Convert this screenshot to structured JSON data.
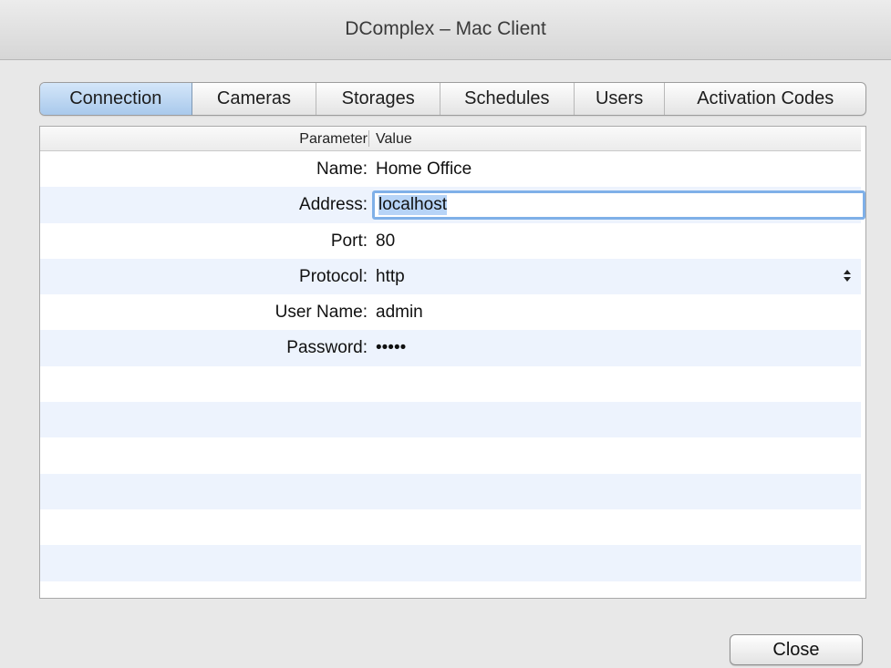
{
  "window": {
    "title": "DComplex – Mac Client"
  },
  "tabs": [
    {
      "label": "Connection",
      "active": true
    },
    {
      "label": "Cameras",
      "active": false
    },
    {
      "label": "Storages",
      "active": false
    },
    {
      "label": "Schedules",
      "active": false
    },
    {
      "label": "Users",
      "active": false
    },
    {
      "label": "Activation Codes",
      "active": false
    }
  ],
  "table": {
    "columns": [
      "Parameter",
      "Value"
    ],
    "rows": [
      {
        "label": "Name:",
        "value": "Home Office"
      },
      {
        "label": "Address:",
        "value": "localhost",
        "editing": true
      },
      {
        "label": "Port:",
        "value": "80"
      },
      {
        "label": "Protocol:",
        "value": "http",
        "control": "up-down-stepper"
      },
      {
        "label": "User Name:",
        "value": "admin"
      },
      {
        "label": "Password:",
        "value": "•••••"
      }
    ]
  },
  "buttons": {
    "close_label": "Close"
  },
  "colors": {
    "active_tab": "#a9c9ec",
    "row_stripe": "#edf3fd",
    "focus_ring": "#7fb0e8"
  }
}
